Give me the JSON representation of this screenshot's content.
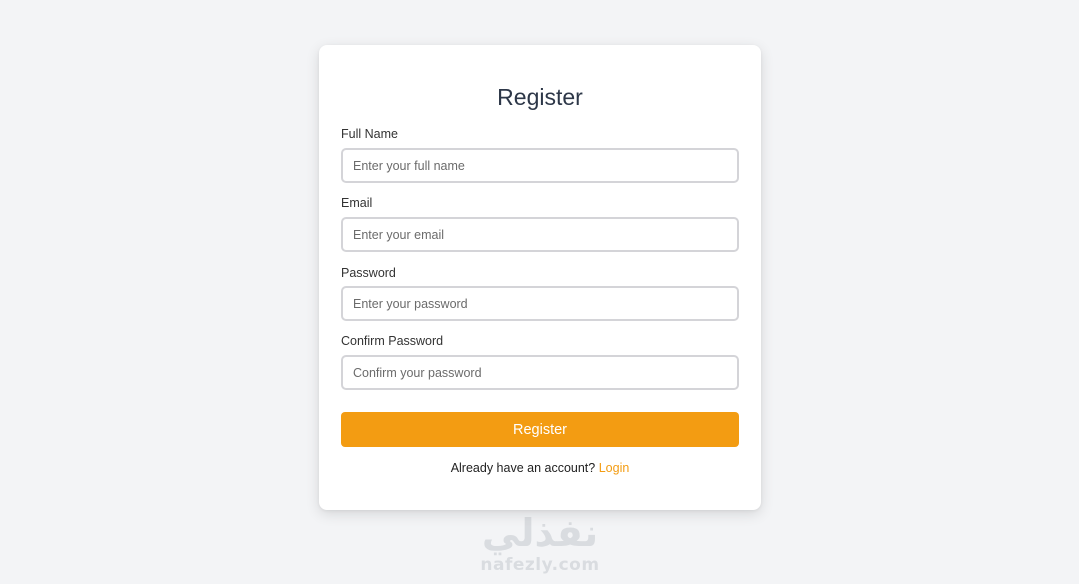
{
  "form": {
    "title": "Register",
    "fields": [
      {
        "label": "Full Name",
        "placeholder": "Enter your full name",
        "type": "text"
      },
      {
        "label": "Email",
        "placeholder": "Enter your email",
        "type": "email"
      },
      {
        "label": "Password",
        "placeholder": "Enter your password",
        "type": "password"
      },
      {
        "label": "Confirm Password",
        "placeholder": "Confirm your password",
        "type": "password"
      }
    ],
    "submit_label": "Register",
    "footer_text": "Already have an account?",
    "login_label": "Login"
  },
  "watermark": {
    "arabic": "نفذلي",
    "latin": "nafezly.com"
  },
  "colors": {
    "accent": "#f39c12",
    "background": "#f3f4f6",
    "card": "#ffffff",
    "title": "#2d3748"
  }
}
